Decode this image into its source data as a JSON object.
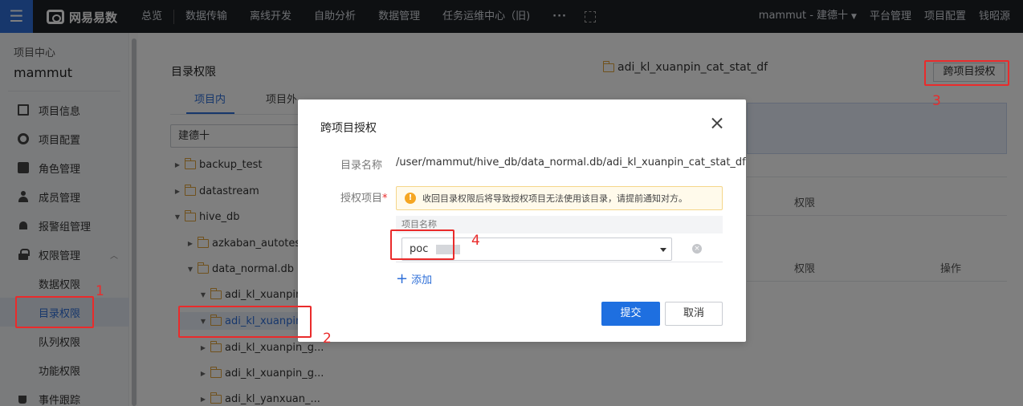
{
  "topbar": {
    "menu_glyph": "☰",
    "logo_text": "网易易数",
    "nav": [
      "总览",
      "数据传输",
      "离线开发",
      "自助分析",
      "数据管理",
      "任务运维中心（旧)"
    ],
    "more": "···",
    "right": {
      "user": "mammut - 建德十",
      "platform": "平台管理",
      "project_config": "项目配置",
      "extra": "钱昭源"
    }
  },
  "sidebar": {
    "section_label": "项目中心",
    "project_name": "mammut",
    "items": [
      {
        "label": "项目信息",
        "icon": "doc-icon"
      },
      {
        "label": "项目配置",
        "icon": "gear-icon"
      },
      {
        "label": "角色管理",
        "icon": "id-card-icon"
      },
      {
        "label": "成员管理",
        "icon": "user-icon"
      },
      {
        "label": "报警组管理",
        "icon": "bell-icon"
      },
      {
        "label": "权限管理",
        "icon": "lock-icon"
      }
    ],
    "sub_items": [
      "数据权限",
      "目录权限",
      "队列权限",
      "功能权限"
    ],
    "bottom_item": {
      "label": "事件跟踪",
      "icon": "cup-icon"
    }
  },
  "tree": {
    "title": "目录权限",
    "tabs": [
      "项目内",
      "项目外"
    ],
    "search_value": "建德十",
    "nodes": [
      "backup_test",
      "datastream",
      "hive_db",
      "azkaban_autotest_",
      "data_normal.db",
      "adi_kl_xuanpin_",
      "adi_kl_xuanpin_",
      "adi_kl_xuanpin_g...",
      "adi_kl_xuanpin_g...",
      "adi_kl_yanxuan_..."
    ]
  },
  "main": {
    "folder_name": "adi_kl_xuanpin_cat_stat_df",
    "cross_button": "跨项目授权",
    "col_perm": "权限",
    "col_action": "操作"
  },
  "modal": {
    "title": "跨项目授权",
    "dir_label": "目录名称",
    "dir_value": "/user/mammut/hive_db/data_normal.db/adi_kl_xuanpin_cat_stat_df",
    "proj_label": "授权项目",
    "required_mark": "*",
    "warning": "收回目录权限后将导致授权项目无法使用该目录，请提前通知对方。",
    "table_header": "项目名称",
    "select_value": "poc",
    "add_label": "添加",
    "submit": "提交",
    "cancel": "取消"
  },
  "annotations": {
    "n1": "1",
    "n2": "2",
    "n3": "3",
    "n4": "4",
    "color": "#ea2b2b"
  },
  "colors": {
    "accent": "#2e6fd8",
    "topbar": "#1d2025",
    "submit": "#1e6fe0"
  }
}
